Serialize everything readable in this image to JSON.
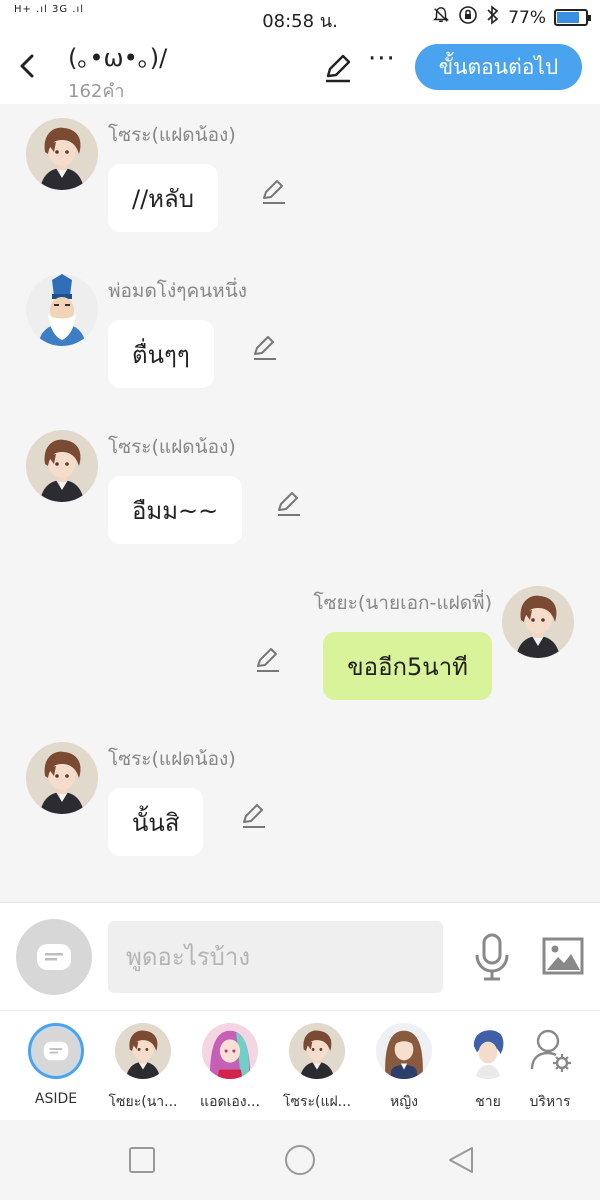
{
  "status_bar": {
    "signal": "H+ .ıl 3G .ıl",
    "time": "08:58 น.",
    "battery": "77%",
    "battery_level": 0.77
  },
  "header": {
    "title": "(｡•ω•｡)/",
    "word_count": "162คำ",
    "next_button": "ขั้นตอนต่อไป"
  },
  "messages": [
    {
      "name": "โซระ(แฝดน้อง)",
      "text": "//หลับ",
      "side": "left",
      "avatar": "brown-hair-boy"
    },
    {
      "name": "พ่อมดโง่ๆคนหนึ่ง",
      "text": "ตื่นๆๆ",
      "side": "left",
      "avatar": "old-wizard"
    },
    {
      "name": "โซระ(แฝดน้อง)",
      "text": "อืมม~~",
      "side": "left",
      "avatar": "brown-hair-boy"
    },
    {
      "name": "โซยะ(นายเอก-แฝดพี่)",
      "text": "ขออีก5นาที",
      "side": "right",
      "avatar": "brown-hair-boy"
    },
    {
      "name": "โซระ(แฝดน้อง)",
      "text": "นั้นสิ",
      "side": "left",
      "avatar": "brown-hair-boy"
    }
  ],
  "composer": {
    "placeholder": "พูดอะไรบ้าง"
  },
  "characters": [
    {
      "label": "ASIDE",
      "avatar": "aside"
    },
    {
      "label": "โซยะ(นา...",
      "avatar": "brown-hair-boy"
    },
    {
      "label": "แอดเอง...",
      "avatar": "pink-hair-girl"
    },
    {
      "label": "โซระ(แฝ...",
      "avatar": "brown-hair-boy"
    },
    {
      "label": "หญิง",
      "avatar": "brown-hair-girl"
    },
    {
      "label": "ชาย",
      "avatar": "blue-hair-boy"
    },
    {
      "label": "บริหาร",
      "avatar": "manage-icon"
    }
  ],
  "colors": {
    "accent": "#4aa3ee",
    "my_bubble": "#d8f39a",
    "bubble": "#ffffff",
    "background": "#f5f5f5"
  }
}
